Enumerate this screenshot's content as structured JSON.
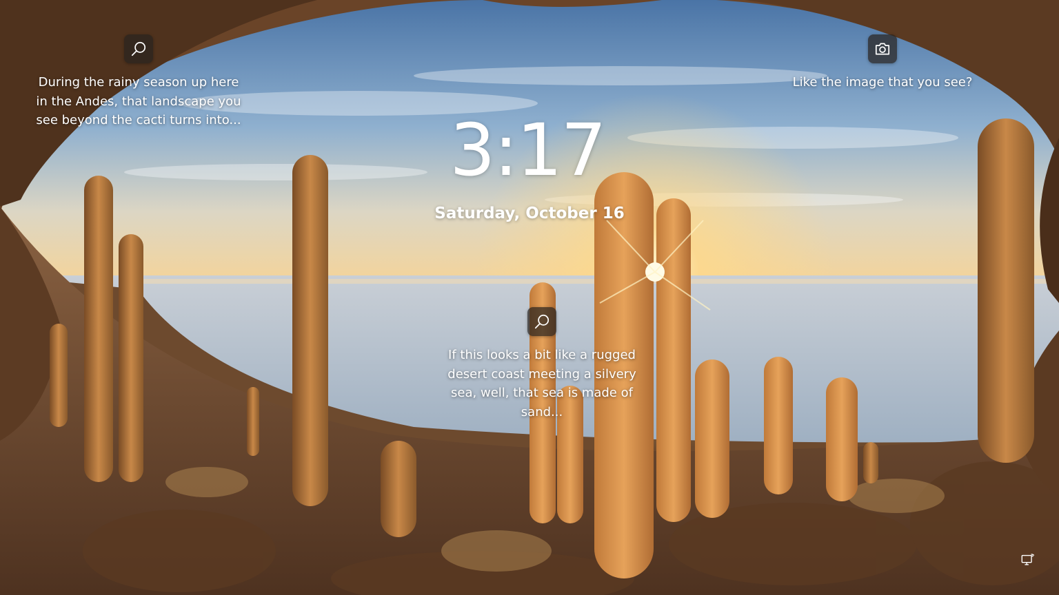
{
  "clock": {
    "time": "3:17",
    "date": "Saturday, October 16"
  },
  "hotspots": [
    {
      "icon": "search-icon",
      "text": "During the rainy season up here in the Andes, that landscape you see beyond the cacti turns into..."
    },
    {
      "icon": "camera-icon",
      "text": "Like the image that you see?"
    },
    {
      "icon": "search-icon",
      "text": "If this looks a bit like a rugged desert coast meeting a silvery sea, well, that sea is made of sand..."
    }
  ],
  "status": {
    "network_icon": "network-icon"
  },
  "colors": {
    "sky_top": "#4f78a8",
    "sky_horizon": "#f2d9a8",
    "salt_flat": "#b9c3cf",
    "rock": "#6b4629",
    "cactus": "#b7783c"
  }
}
